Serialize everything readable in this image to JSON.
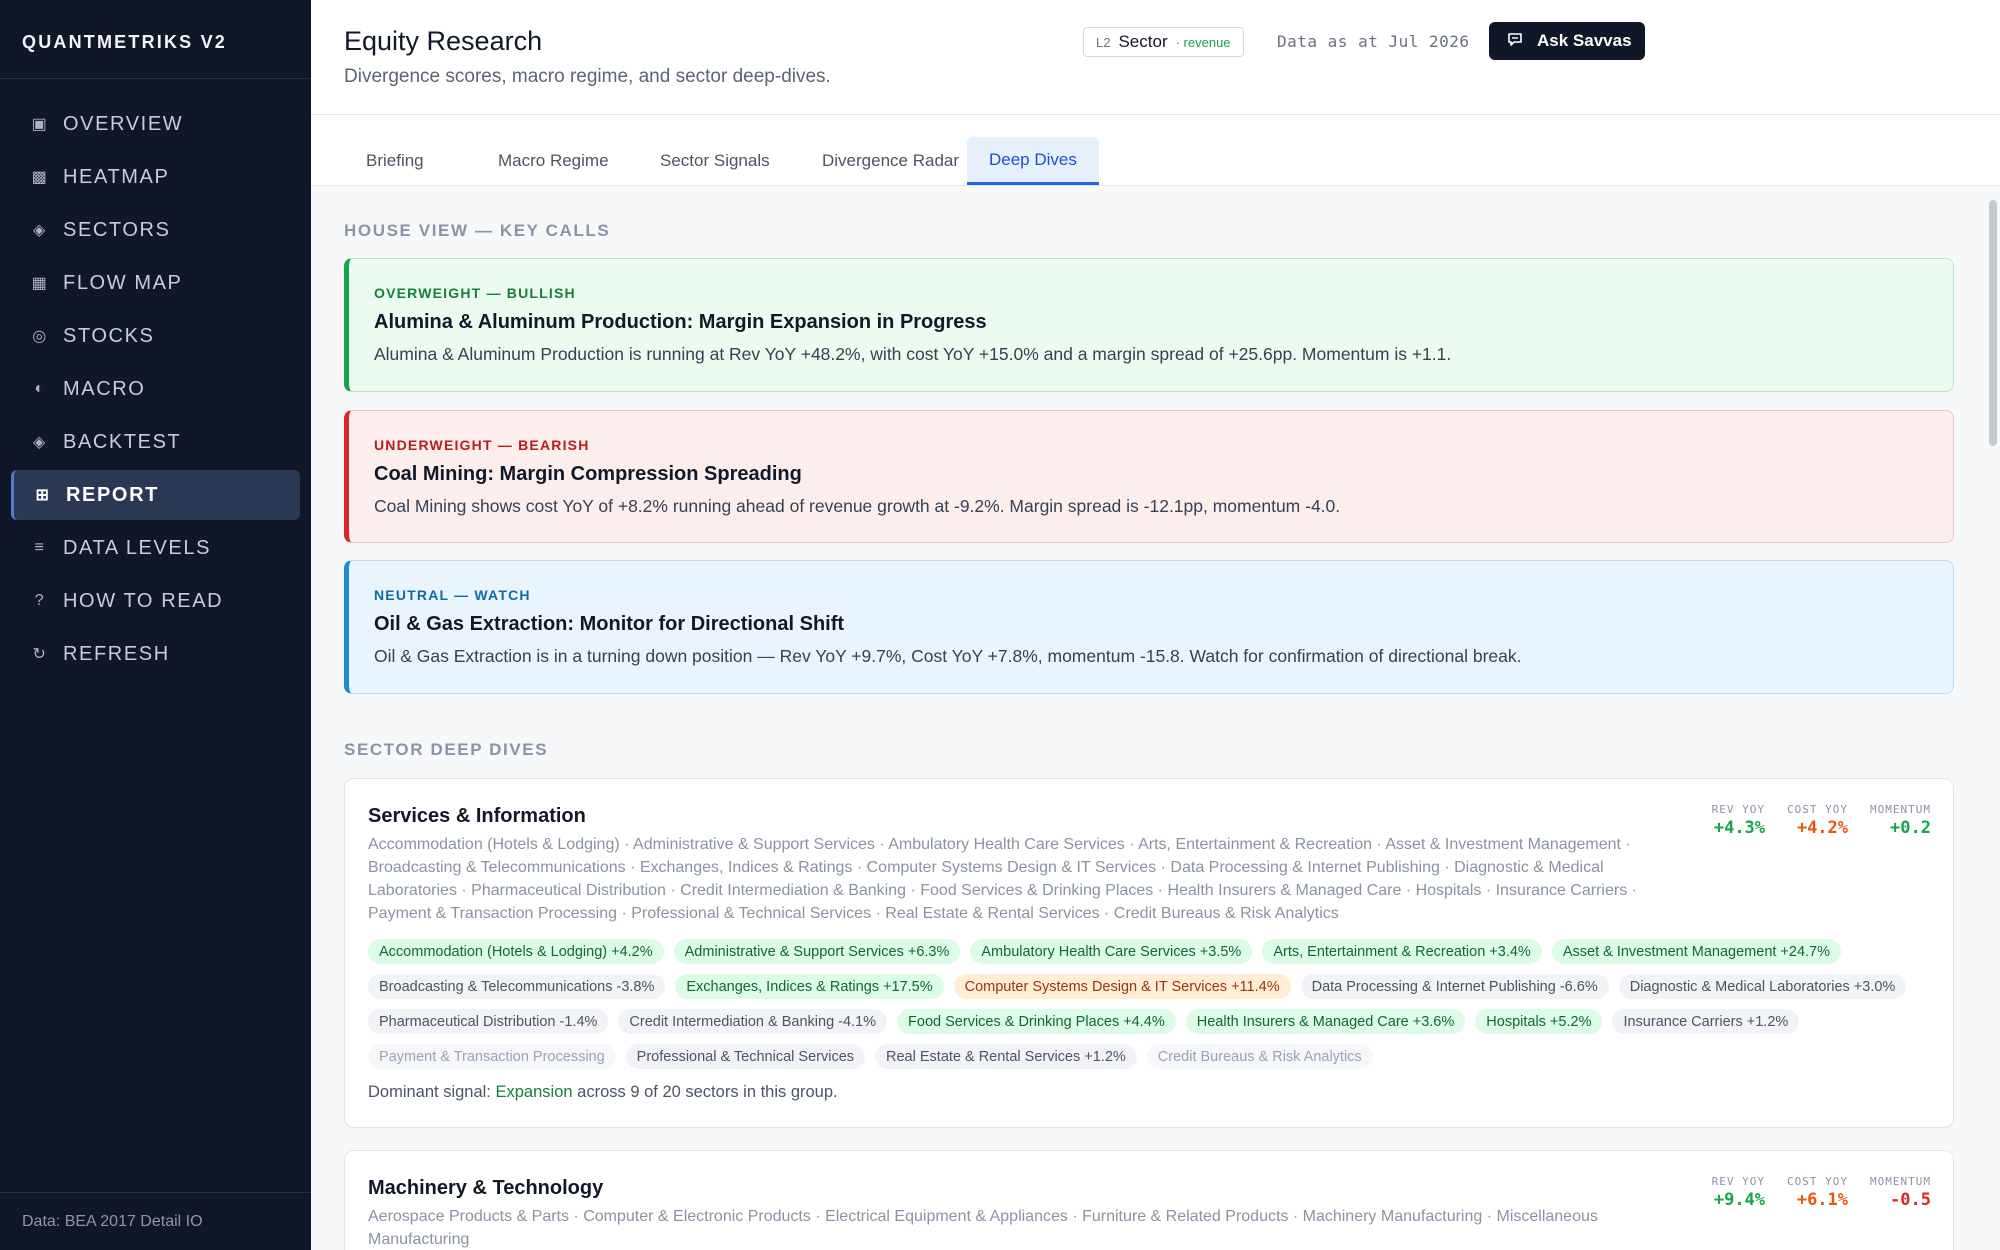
{
  "brand": "QUANTMETRIKS V2",
  "nav": [
    {
      "icon": "▣",
      "label": "OVERVIEW"
    },
    {
      "icon": "▩",
      "label": "HEATMAP"
    },
    {
      "icon": "◈",
      "label": "SECTORS"
    },
    {
      "icon": "▦",
      "label": "FLOW MAP"
    },
    {
      "icon": "◎",
      "label": "STOCKS"
    },
    {
      "icon": "◐",
      "label": "MACRO"
    },
    {
      "icon": "◈",
      "label": "BACKTEST"
    },
    {
      "icon": "⊞",
      "label": "REPORT"
    },
    {
      "icon": "≡",
      "label": "DATA LEVELS"
    },
    {
      "icon": "?",
      "label": "HOW TO READ"
    },
    {
      "icon": "↻",
      "label": "REFRESH"
    }
  ],
  "sidebar_footer": "Data: BEA 2017 Detail IO",
  "header": {
    "title": "Equity Research",
    "subtitle": "Divergence scores, macro regime, and sector deep-dives.",
    "chip_level": "L2",
    "chip_name": "Sector",
    "chip_metric": "· revenue",
    "data_as": "Data as at Jul 2026",
    "ask_label": "Ask Savvas"
  },
  "tabs": [
    "Briefing",
    "Macro Regime",
    "Sector Signals",
    "Divergence Radar",
    "Deep Dives"
  ],
  "house_view": {
    "heading": "HOUSE VIEW — KEY CALLS",
    "calls": [
      {
        "tag": "OVERWEIGHT — BULLISH",
        "title": "Alumina & Aluminum Production: Margin Expansion in Progress",
        "body": "Alumina & Aluminum Production is running at Rev YoY +48.2%, with cost YoY +15.0% and a margin spread of +25.6pp. Momentum is +1.1."
      },
      {
        "tag": "UNDERWEIGHT — BEARISH",
        "title": "Coal Mining: Margin Compression Spreading",
        "body": "Coal Mining shows cost YoY of +8.2% running ahead of revenue growth at -9.2%. Margin spread is -12.1pp, momentum -4.0."
      },
      {
        "tag": "NEUTRAL — WATCH",
        "title": "Oil & Gas Extraction: Monitor for Directional Shift",
        "body": "Oil & Gas Extraction is in a turning down position — Rev YoY +9.7%, Cost YoY +7.8%, momentum -15.8. Watch for confirmation of directional break."
      }
    ]
  },
  "deep_dives": {
    "heading": "SECTOR DEEP DIVES",
    "stat_labels": {
      "rev": "REV YOY",
      "cost": "COST YOY",
      "mom": "MOMENTUM"
    },
    "groups": [
      {
        "title": "Services & Information",
        "list": "Accommodation (Hotels & Lodging) · Administrative & Support Services · Ambulatory Health Care Services · Arts, Entertainment & Recreation · Asset & Investment Management · Broadcasting & Telecommunications · Exchanges, Indices & Ratings · Computer Systems Design & IT Services · Data Processing & Internet Publishing · Diagnostic & Medical Laboratories · Pharmaceutical Distribution · Credit Intermediation & Banking · Food Services & Drinking Places · Health Insurers & Managed Care · Hospitals · Insurance Carriers · Payment & Transaction Processing · Professional & Technical Services · Real Estate & Rental Services · Credit Bureaus & Risk Analytics",
        "rev": "+4.3%",
        "cost": "+4.2%",
        "mom": "+0.2",
        "chips": [
          {
            "text": "Accommodation (Hotels & Lodging) +4.2%",
            "tone": "g"
          },
          {
            "text": "Administrative & Support Services +6.3%",
            "tone": "g"
          },
          {
            "text": "Ambulatory Health Care Services +3.5%",
            "tone": "g"
          },
          {
            "text": "Arts, Entertainment & Recreation +3.4%",
            "tone": "g"
          },
          {
            "text": "Asset & Investment Management +24.7%",
            "tone": "g"
          },
          {
            "text": "Broadcasting & Telecommunications -3.8%",
            "tone": "n"
          },
          {
            "text": "Exchanges, Indices & Ratings +17.5%",
            "tone": "g"
          },
          {
            "text": "Computer Systems Design & IT Services +11.4%",
            "tone": "o"
          },
          {
            "text": "Data Processing & Internet Publishing -6.6%",
            "tone": "n"
          },
          {
            "text": "Diagnostic & Medical Laboratories +3.0%",
            "tone": "n"
          },
          {
            "text": "Pharmaceutical Distribution -1.4%",
            "tone": "n"
          },
          {
            "text": "Credit Intermediation & Banking -4.1%",
            "tone": "n"
          },
          {
            "text": "Food Services & Drinking Places +4.4%",
            "tone": "g"
          },
          {
            "text": "Health Insurers & Managed Care +3.6%",
            "tone": "g"
          },
          {
            "text": "Hospitals +5.2%",
            "tone": "g"
          },
          {
            "text": "Insurance Carriers +1.2%",
            "tone": "n"
          },
          {
            "text": "Payment & Transaction Processing",
            "tone": "m"
          },
          {
            "text": "Professional & Technical Services",
            "tone": "n"
          },
          {
            "text": "Real Estate & Rental Services +1.2%",
            "tone": "n"
          },
          {
            "text": "Credit Bureaus & Risk Analytics",
            "tone": "m"
          }
        ],
        "dominant_prefix": "Dominant signal:",
        "dominant_signal": "Expansion",
        "dominant_suffix": "across 9 of 20 sectors in this group."
      },
      {
        "title": "Machinery & Technology",
        "list": "Aerospace Products & Parts · Computer & Electronic Products · Electrical Equipment & Appliances · Furniture & Related Products · Machinery Manufacturing · Miscellaneous Manufacturing",
        "rev": "+9.4%",
        "cost": "+6.1%",
        "mom": "-0.5"
      }
    ]
  },
  "colors": {
    "sidebar_bg": "#0f1729",
    "accent": "#2563eb",
    "bullish": "#16a34a",
    "bearish": "#dc2626",
    "neutral": "#1d8ad6"
  }
}
